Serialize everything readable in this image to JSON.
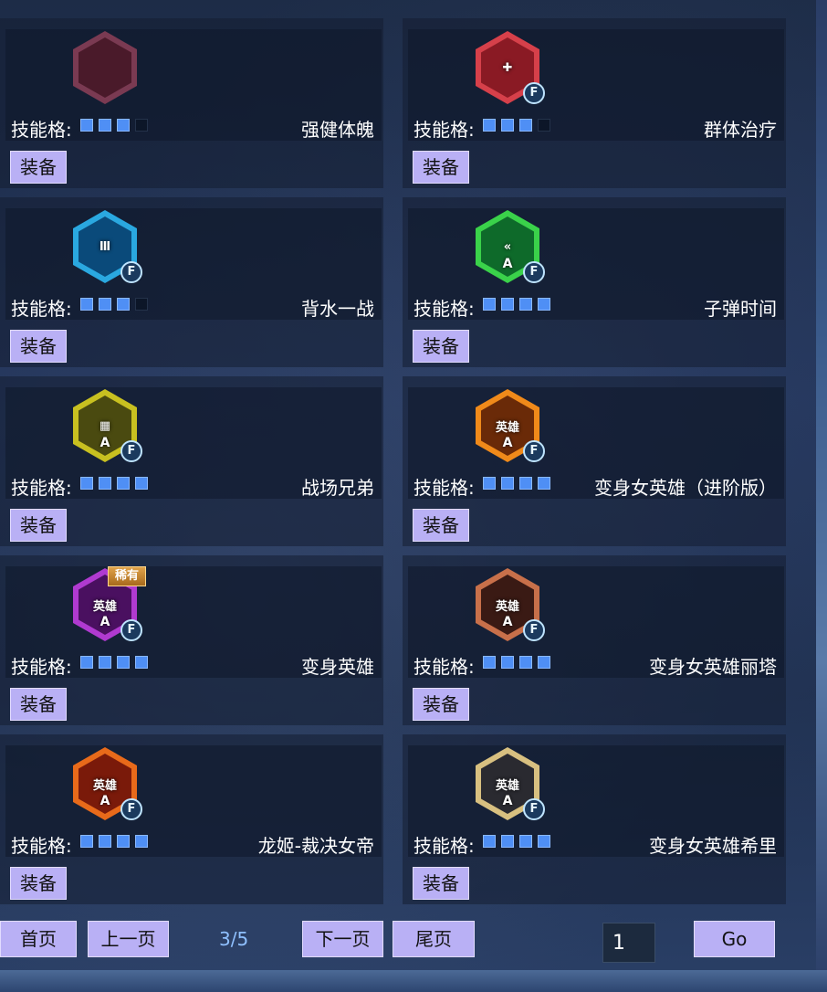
{
  "slot_label": "技能格:",
  "equip_label": "装备",
  "skills": [
    {
      "name": "强健体魄",
      "slots": [
        1,
        1,
        1,
        0
      ],
      "icon": "muscle-icon",
      "hex_color": "#7a3a52",
      "inner_color": "#4a1a2a",
      "glyph": "",
      "tier": "",
      "f_badge": false,
      "rare_tag": ""
    },
    {
      "name": "群体治疗",
      "slots": [
        1,
        1,
        1,
        0
      ],
      "icon": "group-heal-icon",
      "hex_color": "#d6404a",
      "inner_color": "#8a1a24",
      "glyph": "✚",
      "tier": "",
      "f_badge": true,
      "rare_tag": ""
    },
    {
      "name": "背水一战",
      "slots": [
        1,
        1,
        1,
        0
      ],
      "icon": "last-stand-icon",
      "hex_color": "#2aa8e0",
      "inner_color": "#0a4a7a",
      "glyph": "Ⅲ",
      "tier": "",
      "f_badge": true,
      "rare_tag": ""
    },
    {
      "name": "子弹时间",
      "slots": [
        1,
        1,
        1,
        1
      ],
      "icon": "bullet-time-icon",
      "hex_color": "#3ad24a",
      "inner_color": "#0e6a2a",
      "glyph": "«",
      "tier": "A",
      "f_badge": true,
      "rare_tag": ""
    },
    {
      "name": "战场兄弟",
      "slots": [
        1,
        1,
        1,
        1
      ],
      "icon": "battle-brother-icon",
      "hex_color": "#c8c020",
      "inner_color": "#4a4a10",
      "glyph": "▦",
      "tier": "A",
      "f_badge": true,
      "rare_tag": ""
    },
    {
      "name": "变身女英雄（进阶版）",
      "slots": [
        1,
        1,
        1,
        1
      ],
      "icon": "heroine-advanced-icon",
      "hex_color": "#f08a1a",
      "inner_color": "#6a2a08",
      "glyph": "英雄",
      "tier": "A",
      "f_badge": true,
      "rare_tag": ""
    },
    {
      "name": "变身英雄",
      "slots": [
        1,
        1,
        1,
        1
      ],
      "icon": "hero-transform-icon",
      "hex_color": "#b03ad0",
      "inner_color": "#4a1060",
      "glyph": "英雄",
      "tier": "A",
      "f_badge": true,
      "rare_tag": "稀有"
    },
    {
      "name": "变身女英雄丽塔",
      "slots": [
        1,
        1,
        1,
        1
      ],
      "icon": "heroine-rita-icon",
      "hex_color": "#c8704a",
      "inner_color": "#3a1a14",
      "glyph": "英雄",
      "tier": "A",
      "f_badge": true,
      "rare_tag": ""
    },
    {
      "name": "龙姬-裁决女帝",
      "slots": [
        1,
        1,
        1,
        1
      ],
      "icon": "dragon-empress-icon",
      "hex_color": "#e86a1a",
      "inner_color": "#7a1a0a",
      "glyph": "英雄",
      "tier": "A",
      "f_badge": true,
      "rare_tag": ""
    },
    {
      "name": "变身女英雄希里",
      "slots": [
        1,
        1,
        1,
        1
      ],
      "icon": "heroine-ciri-icon",
      "hex_color": "#d8c080",
      "inner_color": "#2a2a30",
      "glyph": "英雄",
      "tier": "A",
      "f_badge": true,
      "rare_tag": ""
    }
  ],
  "f_badge_text": "F",
  "pager": {
    "first": "首页",
    "prev": "上一页",
    "indicator": "3/5",
    "next": "下一页",
    "last": "尾页",
    "page_input": "1",
    "go": "Go"
  }
}
